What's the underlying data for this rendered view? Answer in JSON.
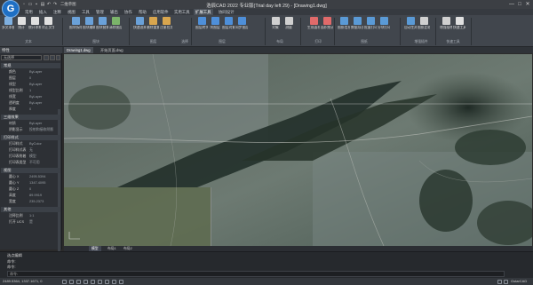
{
  "app": {
    "logo_letter": "G",
    "title": "浩辰CAD 2022 专业版(Trial day left 29) - [Drawing1.dwg]",
    "workspace": "二维草图",
    "window_controls": [
      "—",
      "□",
      "✕"
    ]
  },
  "ribbon_tabs": [
    "常用",
    "插入",
    "注释",
    "视图",
    "工具",
    "管理",
    "输出",
    "协作",
    "帮助",
    "应用软件",
    "实用工具",
    "扩展工具",
    "协同设计"
  ],
  "ribbon_active_tab": 11,
  "ribbon": {
    "buttons": [
      {
        "label": "多文本替换",
        "color": "#7fb0e0"
      },
      {
        "label": "统计",
        "color": "#e0e0e0"
      },
      {
        "label": "统计求和",
        "color": "#e0e0e0"
      },
      {
        "label": "对正文字",
        "color": "#e0e0e0"
      },
      {
        "label": "图块拆除",
        "color": "#6aa1d9"
      },
      {
        "label": "图块编辑",
        "color": "#6aa1d9"
      },
      {
        "label": "图块替换",
        "color": "#6aa1d9"
      },
      {
        "label": "清除图层",
        "color": "#7bb46a"
      },
      {
        "label": "快速选择",
        "color": "#6aa1d9"
      },
      {
        "label": "删除重复",
        "color": "#d9a64e"
      },
      {
        "label": "注册应用",
        "color": "#d9a64e"
      },
      {
        "label": "图层转块",
        "color": "#4e8fd9"
      },
      {
        "label": "块图层",
        "color": "#4e8fd9"
      },
      {
        "label": "图层对象",
        "color": "#4e8fd9"
      },
      {
        "label": "同步图层",
        "color": "#4e8fd9"
      },
      {
        "label": "对象",
        "color": "#d0d0d0"
      },
      {
        "label": "测量",
        "color": "#d0d0d0"
      },
      {
        "label": "生成面积",
        "color": "#e06a6a"
      },
      {
        "label": "面积统计",
        "color": "#e06a6a"
      },
      {
        "label": "图纸信息",
        "color": "#5a9ad6"
      },
      {
        "label": "数据导出",
        "color": "#5a9ad6"
      },
      {
        "label": "批量打印",
        "color": "#5a9ad6"
      },
      {
        "label": "分块打印",
        "color": "#5a9ad6"
      },
      {
        "label": "自动生成",
        "color": "#5a9ad6"
      },
      {
        "label": "图纸比较",
        "color": "#d0d0d0"
      },
      {
        "label": "增强插件",
        "color": "#d0d0d0"
      },
      {
        "label": "快速工具",
        "color": "#e0e0e0"
      }
    ],
    "groups": [
      "文本",
      "图块",
      "图层",
      "选择",
      "图层",
      "布局",
      "打印",
      "图纸",
      "增强插件",
      "快速工具"
    ]
  },
  "doc_tabs": [
    "Drawing1.dwg",
    "开始页面.dwg"
  ],
  "doc_active_tab": 0,
  "properties": {
    "title": "特性",
    "selection": "无选择",
    "sections": [
      {
        "name": "常规",
        "rows": [
          [
            "颜色",
            "ByLayer"
          ],
          [
            "图层",
            "0"
          ],
          [
            "线型",
            "ByLayer"
          ],
          [
            "线型比例",
            "1"
          ],
          [
            "线宽",
            "ByLayer"
          ],
          [
            "透明度",
            "ByLayer"
          ],
          [
            "厚度",
            "0"
          ]
        ]
      },
      {
        "name": "三维效果",
        "rows": [
          [
            "材质",
            "ByLayer"
          ],
          [
            "阴影显示",
            "投射和接收阴影"
          ]
        ]
      },
      {
        "name": "打印样式",
        "rows": [
          [
            "打印样式",
            "ByColor"
          ],
          [
            "打印样式表",
            "无"
          ],
          [
            "打印表附着",
            "模型"
          ],
          [
            "打印表类型",
            "不可用"
          ]
        ]
      },
      {
        "name": "视图",
        "rows": [
          [
            "圆心 X",
            "2495.5394"
          ],
          [
            "圆心 Y",
            "1347.4095"
          ],
          [
            "圆心 Z",
            "0"
          ],
          [
            "高度",
            "89.9919"
          ],
          [
            "宽度",
            "235.2373"
          ]
        ]
      },
      {
        "name": "其他",
        "rows": [
          [
            "注释比例",
            "1:1"
          ],
          [
            "打开 UCS",
            "是"
          ]
        ]
      }
    ]
  },
  "model_tabs": [
    "模型",
    "布局1",
    "布局2"
  ],
  "model_active_tab": 0,
  "command": {
    "lines": [
      "选点编辑",
      "命令:",
      "命令:"
    ],
    "input_placeholder": "命令:"
  },
  "status": {
    "coords": "2489.5364, 1337.1671, 0",
    "brand": "GstarCAD"
  }
}
